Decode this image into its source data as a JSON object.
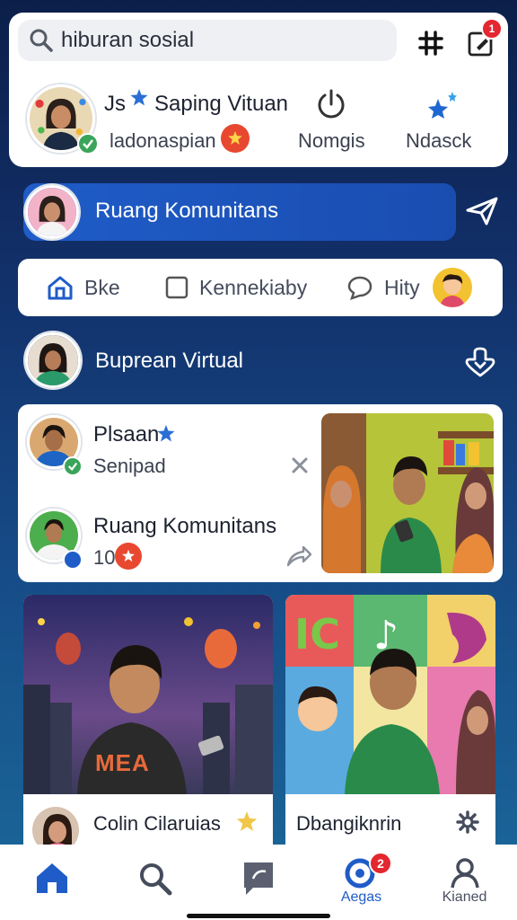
{
  "search": {
    "query": "hiburan sosial",
    "badge_count": "1"
  },
  "profile": {
    "name": "Js",
    "title": "Saping Vituan",
    "subtitle": "ladonaspian",
    "actions": [
      {
        "label": "Nomgis",
        "icon": "power-icon"
      },
      {
        "label": "Ndasck",
        "icon": "sparkle-stars-icon"
      }
    ]
  },
  "community_bar": {
    "label": "Ruang Komunitans"
  },
  "tabs": [
    {
      "label": "Bke",
      "icon": "home-icon"
    },
    {
      "label": "Kennekiaby",
      "icon": "checkbox-icon"
    },
    {
      "label": "Hity",
      "icon": "chat-bubble-icon"
    }
  ],
  "section": {
    "title": "Buprean Virtual"
  },
  "feed": {
    "item1": {
      "name": "Plsaan",
      "subtitle": "Senipad"
    },
    "item2": {
      "name": "Ruang Komunitans",
      "count": "10"
    }
  },
  "posts": [
    {
      "author": "Colin Cilaruias",
      "shirt_text": "MEA"
    },
    {
      "author": "Dbangiknrin"
    }
  ],
  "bottom_nav": [
    {
      "label": "",
      "icon": "home-icon"
    },
    {
      "label": "",
      "icon": "search-icon"
    },
    {
      "label": "",
      "icon": "chat-icon"
    },
    {
      "label": "Aegas",
      "icon": "notification-icon",
      "badge": "2"
    },
    {
      "label": "Kianed",
      "icon": "profile-icon"
    }
  ],
  "colors": {
    "accent": "#1f5cc8",
    "badge": "#e3262f",
    "verify": "#3aa55a"
  }
}
